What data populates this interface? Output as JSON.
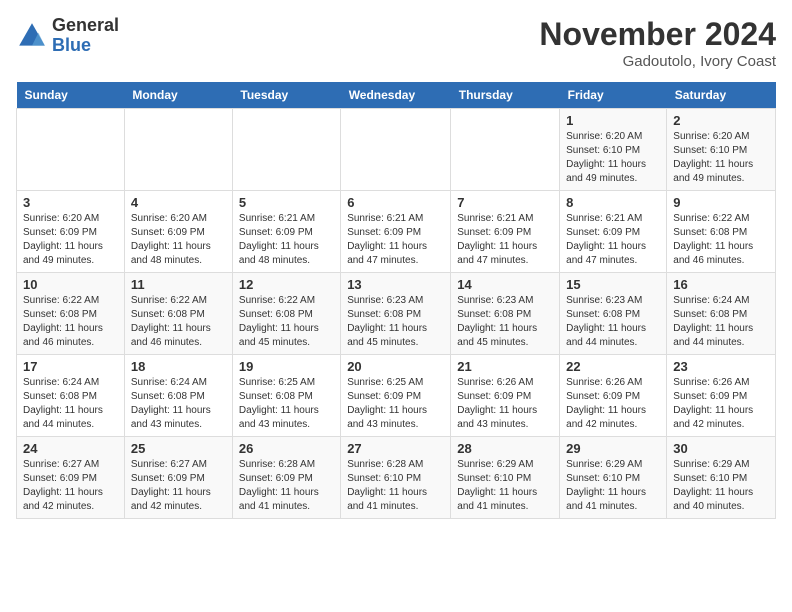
{
  "header": {
    "logo_general": "General",
    "logo_blue": "Blue",
    "month_year": "November 2024",
    "location": "Gadoutolo, Ivory Coast"
  },
  "weekdays": [
    "Sunday",
    "Monday",
    "Tuesday",
    "Wednesday",
    "Thursday",
    "Friday",
    "Saturday"
  ],
  "weeks": [
    [
      {
        "day": "",
        "info": ""
      },
      {
        "day": "",
        "info": ""
      },
      {
        "day": "",
        "info": ""
      },
      {
        "day": "",
        "info": ""
      },
      {
        "day": "",
        "info": ""
      },
      {
        "day": "1",
        "info": "Sunrise: 6:20 AM\nSunset: 6:10 PM\nDaylight: 11 hours and 49 minutes."
      },
      {
        "day": "2",
        "info": "Sunrise: 6:20 AM\nSunset: 6:10 PM\nDaylight: 11 hours and 49 minutes."
      }
    ],
    [
      {
        "day": "3",
        "info": "Sunrise: 6:20 AM\nSunset: 6:09 PM\nDaylight: 11 hours and 49 minutes."
      },
      {
        "day": "4",
        "info": "Sunrise: 6:20 AM\nSunset: 6:09 PM\nDaylight: 11 hours and 48 minutes."
      },
      {
        "day": "5",
        "info": "Sunrise: 6:21 AM\nSunset: 6:09 PM\nDaylight: 11 hours and 48 minutes."
      },
      {
        "day": "6",
        "info": "Sunrise: 6:21 AM\nSunset: 6:09 PM\nDaylight: 11 hours and 47 minutes."
      },
      {
        "day": "7",
        "info": "Sunrise: 6:21 AM\nSunset: 6:09 PM\nDaylight: 11 hours and 47 minutes."
      },
      {
        "day": "8",
        "info": "Sunrise: 6:21 AM\nSunset: 6:09 PM\nDaylight: 11 hours and 47 minutes."
      },
      {
        "day": "9",
        "info": "Sunrise: 6:22 AM\nSunset: 6:08 PM\nDaylight: 11 hours and 46 minutes."
      }
    ],
    [
      {
        "day": "10",
        "info": "Sunrise: 6:22 AM\nSunset: 6:08 PM\nDaylight: 11 hours and 46 minutes."
      },
      {
        "day": "11",
        "info": "Sunrise: 6:22 AM\nSunset: 6:08 PM\nDaylight: 11 hours and 46 minutes."
      },
      {
        "day": "12",
        "info": "Sunrise: 6:22 AM\nSunset: 6:08 PM\nDaylight: 11 hours and 45 minutes."
      },
      {
        "day": "13",
        "info": "Sunrise: 6:23 AM\nSunset: 6:08 PM\nDaylight: 11 hours and 45 minutes."
      },
      {
        "day": "14",
        "info": "Sunrise: 6:23 AM\nSunset: 6:08 PM\nDaylight: 11 hours and 45 minutes."
      },
      {
        "day": "15",
        "info": "Sunrise: 6:23 AM\nSunset: 6:08 PM\nDaylight: 11 hours and 44 minutes."
      },
      {
        "day": "16",
        "info": "Sunrise: 6:24 AM\nSunset: 6:08 PM\nDaylight: 11 hours and 44 minutes."
      }
    ],
    [
      {
        "day": "17",
        "info": "Sunrise: 6:24 AM\nSunset: 6:08 PM\nDaylight: 11 hours and 44 minutes."
      },
      {
        "day": "18",
        "info": "Sunrise: 6:24 AM\nSunset: 6:08 PM\nDaylight: 11 hours and 43 minutes."
      },
      {
        "day": "19",
        "info": "Sunrise: 6:25 AM\nSunset: 6:08 PM\nDaylight: 11 hours and 43 minutes."
      },
      {
        "day": "20",
        "info": "Sunrise: 6:25 AM\nSunset: 6:09 PM\nDaylight: 11 hours and 43 minutes."
      },
      {
        "day": "21",
        "info": "Sunrise: 6:26 AM\nSunset: 6:09 PM\nDaylight: 11 hours and 43 minutes."
      },
      {
        "day": "22",
        "info": "Sunrise: 6:26 AM\nSunset: 6:09 PM\nDaylight: 11 hours and 42 minutes."
      },
      {
        "day": "23",
        "info": "Sunrise: 6:26 AM\nSunset: 6:09 PM\nDaylight: 11 hours and 42 minutes."
      }
    ],
    [
      {
        "day": "24",
        "info": "Sunrise: 6:27 AM\nSunset: 6:09 PM\nDaylight: 11 hours and 42 minutes."
      },
      {
        "day": "25",
        "info": "Sunrise: 6:27 AM\nSunset: 6:09 PM\nDaylight: 11 hours and 42 minutes."
      },
      {
        "day": "26",
        "info": "Sunrise: 6:28 AM\nSunset: 6:09 PM\nDaylight: 11 hours and 41 minutes."
      },
      {
        "day": "27",
        "info": "Sunrise: 6:28 AM\nSunset: 6:10 PM\nDaylight: 11 hours and 41 minutes."
      },
      {
        "day": "28",
        "info": "Sunrise: 6:29 AM\nSunset: 6:10 PM\nDaylight: 11 hours and 41 minutes."
      },
      {
        "day": "29",
        "info": "Sunrise: 6:29 AM\nSunset: 6:10 PM\nDaylight: 11 hours and 41 minutes."
      },
      {
        "day": "30",
        "info": "Sunrise: 6:29 AM\nSunset: 6:10 PM\nDaylight: 11 hours and 40 minutes."
      }
    ]
  ]
}
